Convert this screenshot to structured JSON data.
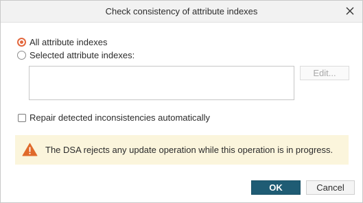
{
  "dialog": {
    "title": "Check consistency of attribute indexes",
    "close_icon": "close-icon"
  },
  "scope": {
    "all_label": "All attribute indexes",
    "all_selected": true,
    "selected_label": "Selected attribute indexes:",
    "selected_selected": false,
    "selected_items": [],
    "edit_label": "Edit..."
  },
  "repair": {
    "label": "Repair detected inconsistencies automatically",
    "checked": false
  },
  "warning": {
    "icon": "warning-icon",
    "text": "The DSA rejects any update operation while this operation is in progress."
  },
  "buttons": {
    "ok_label": "OK",
    "cancel_label": "Cancel"
  },
  "colors": {
    "accent": "#e3683e",
    "primary_button": "#1f5c74",
    "warning_bg": "#fbf5dc",
    "warning_icon": "#e06a2b"
  }
}
